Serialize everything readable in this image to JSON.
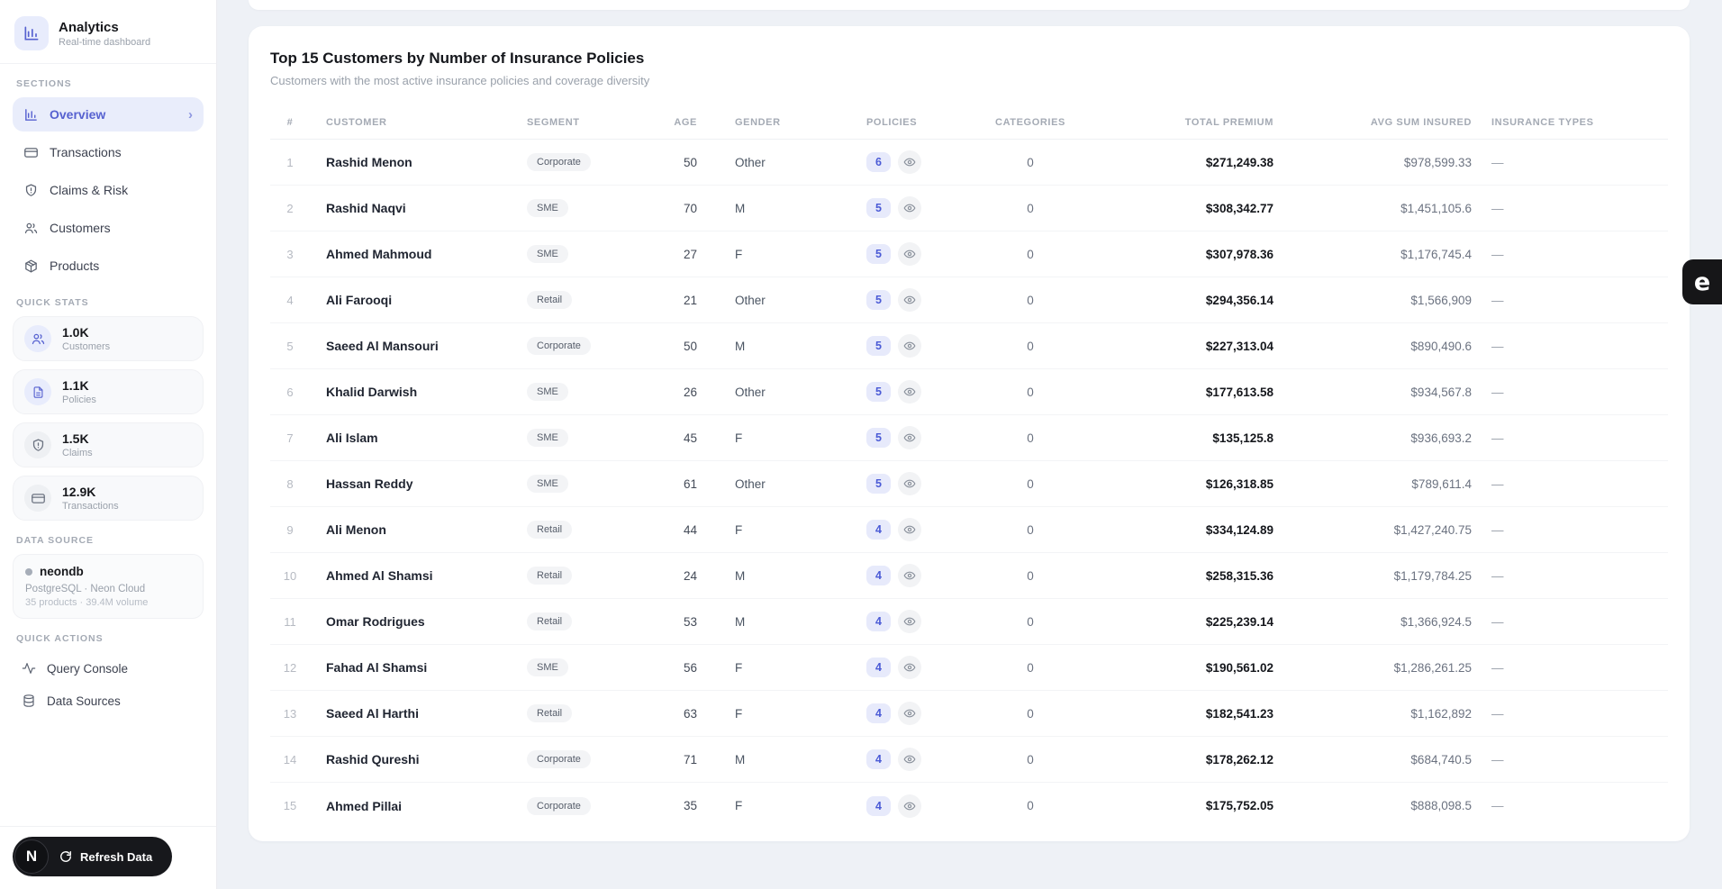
{
  "colors": {
    "accent": "#5661d0",
    "accent_soft": "#e9edfb",
    "badge_bg": "#e7eafb",
    "badge_text": "#4b5bd6",
    "page_bg": "#eef1f6",
    "widget_bg": "#161618",
    "pill_bg": "#17181c"
  },
  "sidebar": {
    "app_title": "Analytics",
    "app_subtitle": "Real-time dashboard",
    "sections_label": "Sections",
    "nav": [
      {
        "label": "Overview",
        "icon": "bar-chart-icon",
        "active": true,
        "chevron": "›"
      },
      {
        "label": "Transactions",
        "icon": "credit-card-icon",
        "active": false
      },
      {
        "label": "Claims & Risk",
        "icon": "shield-alert-icon",
        "active": false
      },
      {
        "label": "Customers",
        "icon": "users-icon",
        "active": false
      },
      {
        "label": "Products",
        "icon": "package-icon",
        "active": false
      }
    ],
    "quick_stats_label": "Quick stats",
    "stats": [
      {
        "value": "1.0K",
        "label": "Customers",
        "icon": "users-icon",
        "tone": "indigo"
      },
      {
        "value": "1.1K",
        "label": "Policies",
        "icon": "file-text-icon",
        "tone": "indigo"
      },
      {
        "value": "1.5K",
        "label": "Claims",
        "icon": "shield-alert-icon",
        "tone": "gray"
      },
      {
        "value": "12.9K",
        "label": "Transactions",
        "icon": "credit-card-icon",
        "tone": "gray"
      }
    ],
    "data_source_label": "Data source",
    "data_source": {
      "name": "neondb",
      "line1": "PostgreSQL · Neon Cloud",
      "line2": "35 products · 39.4M volume"
    },
    "quick_actions_label": "Quick actions",
    "actions": [
      {
        "label": "Query Console",
        "icon": "activity-icon"
      },
      {
        "label": "Data Sources",
        "icon": "database-icon"
      }
    ],
    "refresh_label": "Refresh Data",
    "logo_glyph": "N"
  },
  "main": {
    "card_title": "Top 15 Customers by Number of Insurance Policies",
    "card_subtitle": "Customers with the most active insurance policies and coverage diversity",
    "table": {
      "columns": [
        "#",
        "Customer",
        "Segment",
        "Age",
        "Gender",
        "Policies",
        "Categories",
        "Total Premium",
        "Avg Sum Insured",
        "Insurance Types"
      ],
      "rows": [
        {
          "rank": 1,
          "customer": "Rashid Menon",
          "segment": "Corporate",
          "age": 50,
          "gender": "Other",
          "policies": 6,
          "categories": 0,
          "total_premium": "$271,249.38",
          "avg_sum_insured": "$978,599.33",
          "insurance_types": "—"
        },
        {
          "rank": 2,
          "customer": "Rashid Naqvi",
          "segment": "SME",
          "age": 70,
          "gender": "M",
          "policies": 5,
          "categories": 0,
          "total_premium": "$308,342.77",
          "avg_sum_insured": "$1,451,105.6",
          "insurance_types": "—"
        },
        {
          "rank": 3,
          "customer": "Ahmed Mahmoud",
          "segment": "SME",
          "age": 27,
          "gender": "F",
          "policies": 5,
          "categories": 0,
          "total_premium": "$307,978.36",
          "avg_sum_insured": "$1,176,745.4",
          "insurance_types": "—"
        },
        {
          "rank": 4,
          "customer": "Ali Farooqi",
          "segment": "Retail",
          "age": 21,
          "gender": "Other",
          "policies": 5,
          "categories": 0,
          "total_premium": "$294,356.14",
          "avg_sum_insured": "$1,566,909",
          "insurance_types": "—"
        },
        {
          "rank": 5,
          "customer": "Saeed Al Mansouri",
          "segment": "Corporate",
          "age": 50,
          "gender": "M",
          "policies": 5,
          "categories": 0,
          "total_premium": "$227,313.04",
          "avg_sum_insured": "$890,490.6",
          "insurance_types": "—"
        },
        {
          "rank": 6,
          "customer": "Khalid Darwish",
          "segment": "SME",
          "age": 26,
          "gender": "Other",
          "policies": 5,
          "categories": 0,
          "total_premium": "$177,613.58",
          "avg_sum_insured": "$934,567.8",
          "insurance_types": "—"
        },
        {
          "rank": 7,
          "customer": "Ali Islam",
          "segment": "SME",
          "age": 45,
          "gender": "F",
          "policies": 5,
          "categories": 0,
          "total_premium": "$135,125.8",
          "avg_sum_insured": "$936,693.2",
          "insurance_types": "—"
        },
        {
          "rank": 8,
          "customer": "Hassan Reddy",
          "segment": "SME",
          "age": 61,
          "gender": "Other",
          "policies": 5,
          "categories": 0,
          "total_premium": "$126,318.85",
          "avg_sum_insured": "$789,611.4",
          "insurance_types": "—"
        },
        {
          "rank": 9,
          "customer": "Ali Menon",
          "segment": "Retail",
          "age": 44,
          "gender": "F",
          "policies": 4,
          "categories": 0,
          "total_premium": "$334,124.89",
          "avg_sum_insured": "$1,427,240.75",
          "insurance_types": "—"
        },
        {
          "rank": 10,
          "customer": "Ahmed Al Shamsi",
          "segment": "Retail",
          "age": 24,
          "gender": "M",
          "policies": 4,
          "categories": 0,
          "total_premium": "$258,315.36",
          "avg_sum_insured": "$1,179,784.25",
          "insurance_types": "—"
        },
        {
          "rank": 11,
          "customer": "Omar Rodrigues",
          "segment": "Retail",
          "age": 53,
          "gender": "M",
          "policies": 4,
          "categories": 0,
          "total_premium": "$225,239.14",
          "avg_sum_insured": "$1,366,924.5",
          "insurance_types": "—"
        },
        {
          "rank": 12,
          "customer": "Fahad Al Shamsi",
          "segment": "SME",
          "age": 56,
          "gender": "F",
          "policies": 4,
          "categories": 0,
          "total_premium": "$190,561.02",
          "avg_sum_insured": "$1,286,261.25",
          "insurance_types": "—"
        },
        {
          "rank": 13,
          "customer": "Saeed Al Harthi",
          "segment": "Retail",
          "age": 63,
          "gender": "F",
          "policies": 4,
          "categories": 0,
          "total_premium": "$182,541.23",
          "avg_sum_insured": "$1,162,892",
          "insurance_types": "—"
        },
        {
          "rank": 14,
          "customer": "Rashid Qureshi",
          "segment": "Corporate",
          "age": 71,
          "gender": "M",
          "policies": 4,
          "categories": 0,
          "total_premium": "$178,262.12",
          "avg_sum_insured": "$684,740.5",
          "insurance_types": "—"
        },
        {
          "rank": 15,
          "customer": "Ahmed Pillai",
          "segment": "Corporate",
          "age": 35,
          "gender": "F",
          "policies": 4,
          "categories": 0,
          "total_premium": "$175,752.05",
          "avg_sum_insured": "$888,098.5",
          "insurance_types": "—"
        }
      ]
    }
  },
  "floating_widget": {
    "glyph": "e"
  }
}
